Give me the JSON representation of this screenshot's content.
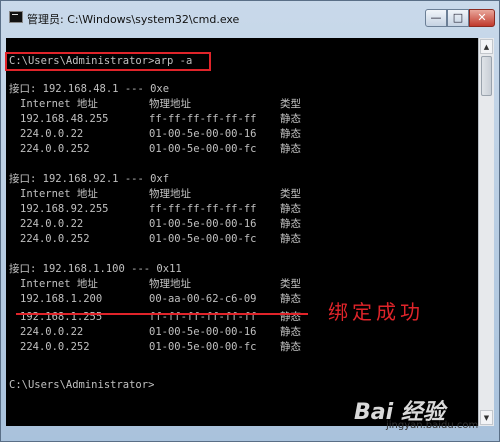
{
  "window": {
    "title": "管理员: C:\\Windows\\system32\\cmd.exe",
    "icon": "cmd-icon",
    "controls": {
      "minimize": "—",
      "maximize": "□",
      "close": "✕"
    }
  },
  "console": {
    "command_line": "C:\\Users\\Administrator>arp -a",
    "interfaces": [
      {
        "header": "接口: 192.168.48.1 --- 0xe",
        "columns": {
          "internet": "Internet 地址",
          "physical": "物理地址",
          "type": "类型"
        },
        "rows": [
          {
            "ip": "192.168.48.255",
            "mac": "ff-ff-ff-ff-ff-ff",
            "type": "静态"
          },
          {
            "ip": "224.0.0.22",
            "mac": "01-00-5e-00-00-16",
            "type": "静态"
          },
          {
            "ip": "224.0.0.252",
            "mac": "01-00-5e-00-00-fc",
            "type": "静态"
          }
        ]
      },
      {
        "header": "接口: 192.168.92.1 --- 0xf",
        "columns": {
          "internet": "Internet 地址",
          "physical": "物理地址",
          "type": "类型"
        },
        "rows": [
          {
            "ip": "192.168.92.255",
            "mac": "ff-ff-ff-ff-ff-ff",
            "type": "静态"
          },
          {
            "ip": "224.0.0.22",
            "mac": "01-00-5e-00-00-16",
            "type": "静态"
          },
          {
            "ip": "224.0.0.252",
            "mac": "01-00-5e-00-00-fc",
            "type": "静态"
          }
        ]
      },
      {
        "header": "接口: 192.168.1.100 --- 0x11",
        "columns": {
          "internet": "Internet 地址",
          "physical": "物理地址",
          "type": "类型"
        },
        "rows": [
          {
            "ip": "192.168.1.200",
            "mac": "00-aa-00-62-c6-09",
            "type": "静态"
          },
          {
            "ip": "192.168.1.255",
            "mac": "ff-ff-ff-ff-ff-ff",
            "type": "静态"
          },
          {
            "ip": "224.0.0.22",
            "mac": "01-00-5e-00-00-16",
            "type": "静态"
          },
          {
            "ip": "224.0.0.252",
            "mac": "01-00-5e-00-00-fc",
            "type": "静态"
          }
        ]
      }
    ],
    "prompt": "C:\\Users\\Administrator>"
  },
  "annotation": {
    "text": "绑定成功",
    "color": "#e0242a"
  },
  "watermark": {
    "brand": "Bai 经验",
    "site": "jingyan.baidu.com"
  },
  "colors": {
    "console_bg": "#000000",
    "console_text": "#c0c0c0",
    "highlight": "#e0242a"
  }
}
